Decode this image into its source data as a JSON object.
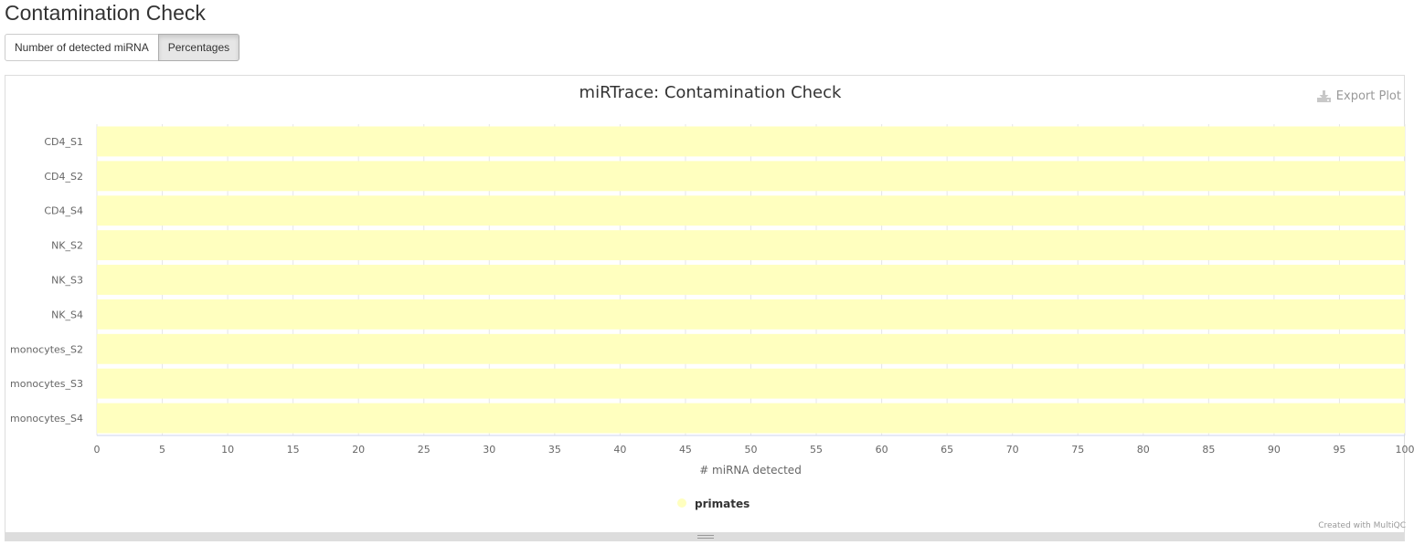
{
  "page": {
    "title": "Contamination Check"
  },
  "toggle": {
    "buttons": [
      {
        "label": "Number of detected miRNA",
        "active": false
      },
      {
        "label": "Percentages",
        "active": true
      }
    ]
  },
  "export": {
    "label": "Export Plot",
    "icon": "download-icon"
  },
  "credit": "Created with MultiQC",
  "colors": {
    "primates": "#ffffbf"
  },
  "chart_data": {
    "type": "bar",
    "orientation": "horizontal",
    "stacked": true,
    "title": "miRTrace: Contamination Check",
    "xlabel": "# miRNA detected",
    "ylabel": "",
    "categories": [
      "CD4_S1",
      "CD4_S2",
      "CD4_S4",
      "NK_S2",
      "NK_S3",
      "NK_S4",
      "monocytes_S2",
      "monocytes_S3",
      "monocytes_S4"
    ],
    "series": [
      {
        "name": "primates",
        "color": "#ffffbf",
        "values": [
          100,
          100,
          100,
          100,
          100,
          100,
          100,
          100,
          100
        ]
      }
    ],
    "xlim": [
      0,
      100
    ],
    "xticks": [
      0,
      5,
      10,
      15,
      20,
      25,
      30,
      35,
      40,
      45,
      50,
      55,
      60,
      65,
      70,
      75,
      80,
      85,
      90,
      95,
      100
    ],
    "grid": true,
    "legend": "bottom-center"
  }
}
